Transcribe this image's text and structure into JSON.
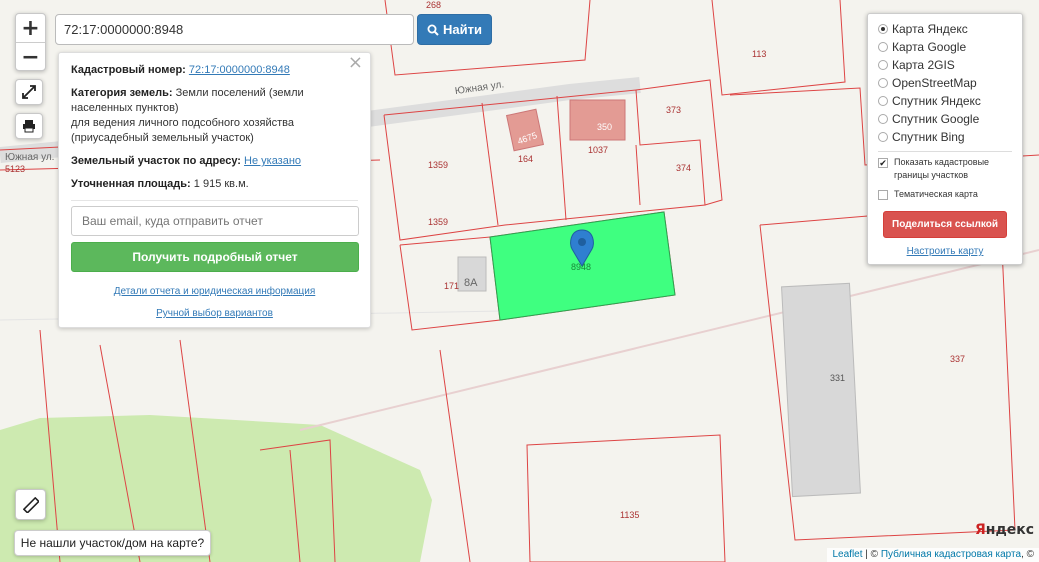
{
  "search": {
    "value": "72:17:0000000:8948",
    "button_label": "Найти"
  },
  "zoom": {
    "in": "+",
    "out": "−"
  },
  "info_panel": {
    "cadastral_label": "Кадастровый номер:",
    "cadastral_value": "72:17:0000000:8948",
    "category_label": "Категория земель:",
    "category_value": "Земли поселений (земли населенных пунктов)",
    "category_line2": "для ведения личного подсобного хозяйства",
    "category_line3": "(приусадебный земельный участок)",
    "address_label": "Земельный участок по адресу:",
    "address_value": "Не указано",
    "area_label": "Уточненная площадь:",
    "area_value": "1 915 кв.м.",
    "email_placeholder": "Ваш email, куда отправить отчет",
    "report_button": "Получить подробный отчет",
    "details_link": "Детали отчета и юридическая информация",
    "manual_link": "Ручной выбор вариантов"
  },
  "layers": {
    "options": [
      {
        "label": "Карта Яндекс",
        "selected": true
      },
      {
        "label": "Карта Google",
        "selected": false
      },
      {
        "label": "Карта 2GIS",
        "selected": false
      },
      {
        "label": "OpenStreetMap",
        "selected": false
      },
      {
        "label": "Спутник Яндекс",
        "selected": false
      },
      {
        "label": "Спутник Google",
        "selected": false
      },
      {
        "label": "Спутник Bing",
        "selected": false
      }
    ],
    "show_borders": "Показать кадастровые границы участков",
    "thematic": "Тематическая карта",
    "share_button": "Поделиться ссылкой",
    "setup_link": "Настроить карту"
  },
  "not_found_button": "Не нашли участок/дом на карте?",
  "attribution": {
    "leaflet": "Leaflet",
    "separator": " | © ",
    "pkk": "Публичная кадастровая карта",
    "suffix": ", ©"
  },
  "map_labels": {
    "street": "Южная ул.",
    "street2": "Южная ул.",
    "p113": "113",
    "p373": "373",
    "p1359a": "1359",
    "p164": "164",
    "p1037": "1037",
    "p374": "374",
    "p1359b": "1359",
    "p171": "171",
    "b8a": "8А",
    "p337": "337",
    "p331": "331",
    "p1135": "1135",
    "p268": "268",
    "b350": "350",
    "b4675": "4675",
    "p5123": "5123",
    "p8948": "8948"
  },
  "yandex_logo": {
    "y": "Я",
    "rest": "ндекс"
  }
}
